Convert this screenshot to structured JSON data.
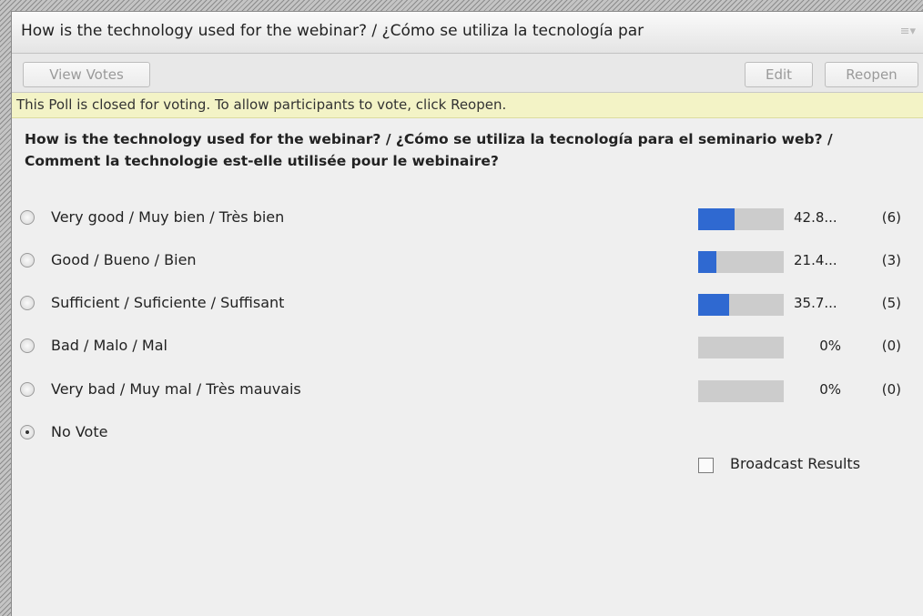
{
  "titlebar": {
    "title": "How is the technology used for the webinar? / ¿Cómo se utiliza la tecnología par",
    "menu_icon": "menu-icon"
  },
  "toolbar": {
    "view_votes_label": "View Votes",
    "edit_label": "Edit",
    "reopen_label": "Reopen"
  },
  "notice": "This Poll is closed for voting. To allow participants to vote, click Reopen.",
  "poll": {
    "question": "How is the technology used for the webinar? / ¿Cómo se utiliza la tecnología para el seminario web? / Comment la technologie est-elle utilisée pour le webinaire?",
    "options": [
      {
        "label": "Very good / Muy bien / Très bien",
        "percent_text": "42.8...",
        "count_text": "(6)",
        "fill_fraction": 0.428
      },
      {
        "label": "Good / Bueno / Bien",
        "percent_text": "21.4...",
        "count_text": "(3)",
        "fill_fraction": 0.214
      },
      {
        "label": "Sufficient / Suficiente / Suffisant",
        "percent_text": "35.7...",
        "count_text": "(5)",
        "fill_fraction": 0.357
      },
      {
        "label": "Bad / Malo / Mal",
        "percent_text": "0%",
        "count_text": "(0)",
        "fill_fraction": 0
      },
      {
        "label": "Very bad / Muy mal / Très mauvais",
        "percent_text": "0%",
        "count_text": "(0)",
        "fill_fraction": 0
      },
      {
        "label": "No Vote",
        "selected": true
      }
    ]
  },
  "broadcast": {
    "label": "Broadcast Results",
    "checked": false
  },
  "colors": {
    "bar_fill": "#2f69d1",
    "bar_track": "#cccccc",
    "notice_bg": "#f3f3c6"
  }
}
